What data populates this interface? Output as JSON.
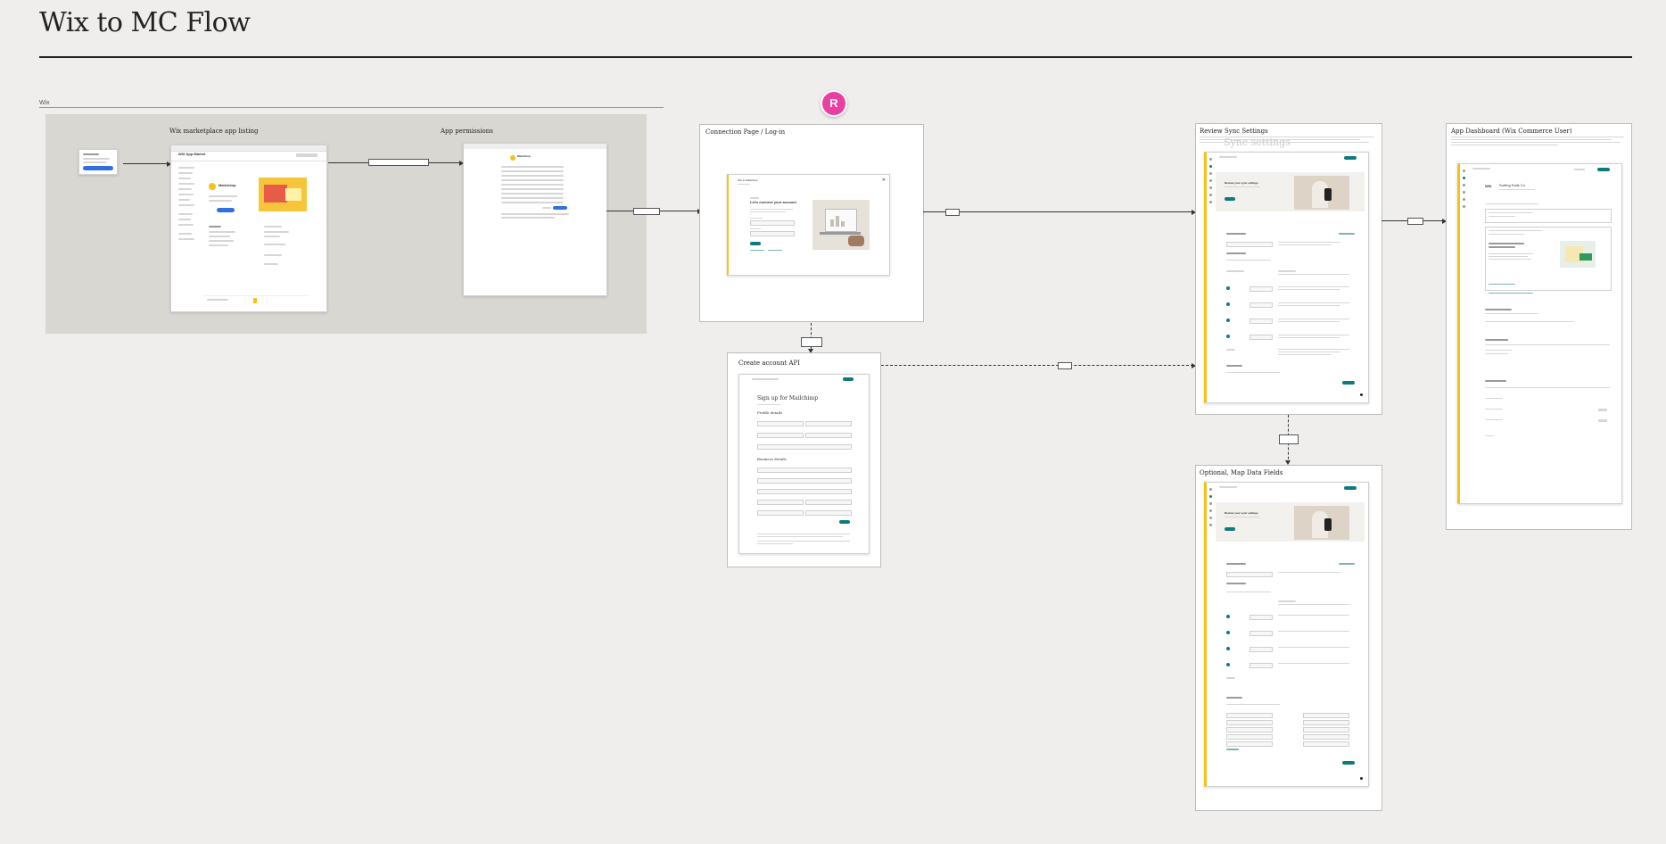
{
  "page": {
    "title": "Wix to MC Flow",
    "section_label": "Wix"
  },
  "collaborator": {
    "initial": "R",
    "color": "#ea3fa1"
  },
  "frames": {
    "marketplace": {
      "label": "Wix marketplace app listing"
    },
    "permissions": {
      "label": "App permissions"
    },
    "connection": {
      "label": "Connection Page / Log-in"
    },
    "create_account": {
      "label": "Create account API"
    },
    "review_sync": {
      "label": "Review Sync Settings",
      "ghost_text": "Sync settings"
    },
    "map_fields": {
      "label": "Optional, Map Data Fields"
    },
    "dashboard": {
      "label": "App Dashboard (Wix Commerce User)"
    }
  },
  "screens": {
    "marketplace_app": {
      "app_name": "Mailchimp",
      "brand": "WIX App Market"
    },
    "permissions_app": {
      "app_name": "Mailchimp"
    },
    "connection_form": {
      "heading": "Let's connect your account",
      "window_title": "Wix to Mailchimp"
    },
    "signup_form": {
      "heading": "Sign up for Mailchimp",
      "profile_section": "Profile details",
      "business_section": "Business details"
    },
    "sync_settings": {
      "heading": "Review your sync settings"
    },
    "map_settings": {
      "heading": "Review your sync settings"
    },
    "dashboard_screen": {
      "store_name": "Surfing Suits Co.",
      "brand": "WIX"
    }
  },
  "colors": {
    "canvas": "#efeeec",
    "wix_section": "#d9d7d2",
    "mailchimp_accent": "#f2c318",
    "primary_teal": "#0f7a7e",
    "wix_blue": "#2f6fdf"
  }
}
